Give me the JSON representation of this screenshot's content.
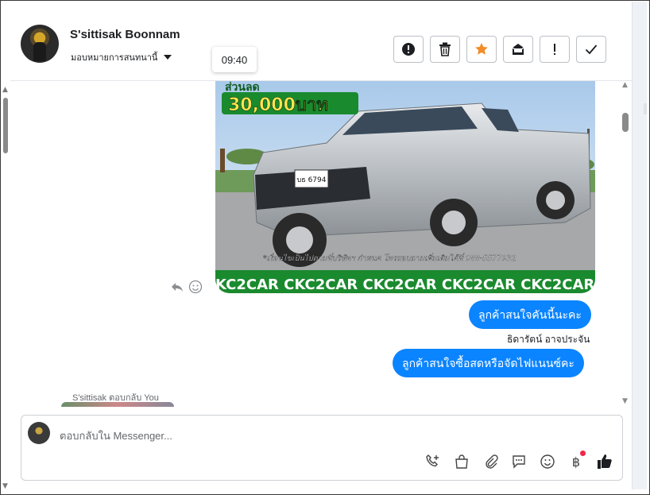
{
  "header": {
    "contact_name": "S'sittisak Boonnam",
    "assign_label": "มอบหมายการสนทนานี้",
    "timestamp_tooltip": "09:40",
    "actions": [
      {
        "icon": "alert-circle-icon",
        "label": "spam"
      },
      {
        "icon": "trash-icon",
        "label": "delete"
      },
      {
        "icon": "star-icon",
        "label": "star"
      },
      {
        "icon": "mail-icon",
        "label": "mark unread"
      },
      {
        "icon": "exclamation-icon",
        "label": "follow up"
      },
      {
        "icon": "check-icon",
        "label": "done"
      }
    ]
  },
  "thread": {
    "image": {
      "promo_headline": "ส่วนลด",
      "promo_amount": "30,000บาท",
      "plate_text": "บธ 6794",
      "footer_note": "*เงื่อนไขเป็นไปตามที่บริษัทฯ กำหนด โทรสอบถามเพิ่มเติมได้ที่ 088-5577932",
      "banner_text": "KC2CAR CKC2CAR CKC2CAR CKC2CAR CKC2CAR CKC2"
    },
    "messages": [
      {
        "text": "ลูกค้าสนใจคันนี้นะคะ"
      },
      {
        "text": "ลูกค้าสนใจซื้อสดหรือจัดไฟแนนซ์คะ"
      }
    ],
    "sender_label": "ธิดารัตน์ อาจประจัน",
    "reply_preview_label": "S'sittisak ตอบกลับ You"
  },
  "composer": {
    "placeholder": "ตอบกลับใน Messenger...",
    "tools": [
      "phone-add-icon",
      "shop-icon",
      "paperclip-icon",
      "chat-bubble-icon",
      "emoji-icon",
      "baht-icon",
      "thumbs-up-icon"
    ]
  },
  "colors": {
    "bubble_blue": "#0b84ff",
    "star_orange": "#f28c28",
    "notify_red": "#f02849",
    "promo_green": "#1a8a2e"
  }
}
